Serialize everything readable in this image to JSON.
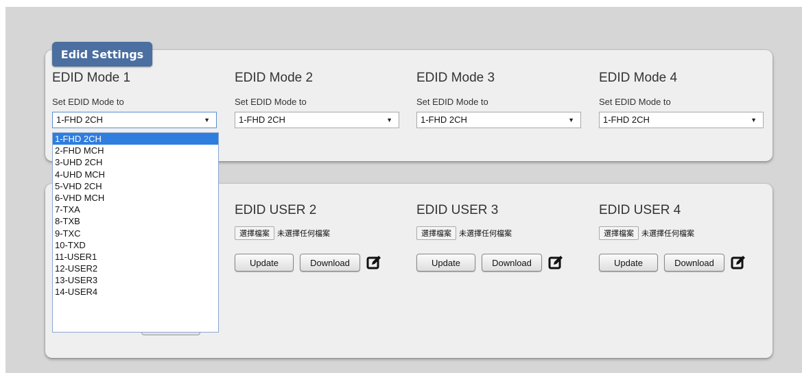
{
  "panel_tab": "Edid Settings",
  "modes": [
    {
      "title": "EDID Mode 1",
      "subtitle": "Set EDID Mode to",
      "selected": "1-FHD 2CH"
    },
    {
      "title": "EDID Mode 2",
      "subtitle": "Set EDID Mode to",
      "selected": "1-FHD 2CH"
    },
    {
      "title": "EDID Mode 3",
      "subtitle": "Set EDID Mode to",
      "selected": "1-FHD 2CH"
    },
    {
      "title": "EDID Mode 4",
      "subtitle": "Set EDID Mode to",
      "selected": "1-FHD 2CH"
    }
  ],
  "dropdown_options": [
    "1-FHD 2CH",
    "2-FHD MCH",
    "3-UHD 2CH",
    "4-UHD MCH",
    "5-VHD 2CH",
    "6-VHD MCH",
    "7-TXA",
    "8-TXB",
    "9-TXC",
    "10-TXD",
    "11-USER1",
    "12-USER2",
    "13-USER3",
    "14-USER4"
  ],
  "users": [
    {
      "title": "EDID USER 2",
      "choose_file": "選擇檔案",
      "no_file": "未選擇任何檔案",
      "update": "Update",
      "download": "Download"
    },
    {
      "title": "EDID USER 3",
      "choose_file": "選擇檔案",
      "no_file": "未選擇任何檔案",
      "update": "Update",
      "download": "Download"
    },
    {
      "title": "EDID USER 4",
      "choose_file": "選擇檔案",
      "no_file": "未選擇任何檔案",
      "update": "Update",
      "download": "Download"
    }
  ],
  "icons": {
    "select_arrow": "▼",
    "edit": "edit-icon"
  },
  "colors": {
    "tab_bg": "#4a6fa0",
    "selected_option": "#2f7ddf",
    "page_bg": "#d6d6d6",
    "panel_bg": "#efefef"
  }
}
